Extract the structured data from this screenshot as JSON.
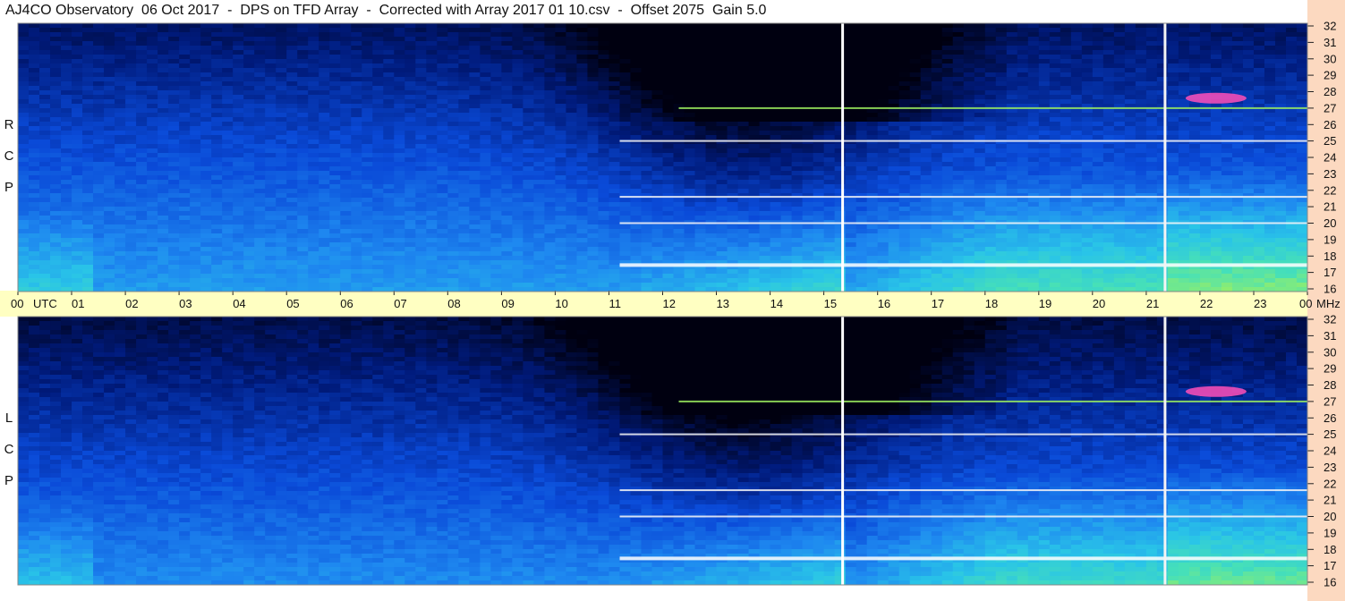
{
  "title": "AJ4CO Observatory  06 Oct 2017  -  DPS on TFD Array  -  Corrected with Array 2017 01 10.csv  -  Offset 2075  Gain 5.0",
  "panels": {
    "top_label": [
      "R",
      "C",
      "P"
    ],
    "bottom_label": [
      "L",
      "C",
      "P"
    ]
  },
  "colors": {
    "background": "#ffffff",
    "utc_bar": "#ffffc2",
    "freq_strip": "#fcd9c0",
    "colormap": [
      "#000010",
      "#001a7a",
      "#0a4ad8",
      "#1e88f0",
      "#29c4e8",
      "#46e0b8",
      "#9ef060",
      "#f0f030",
      "#ff60c0",
      "#ffffff"
    ]
  },
  "chart_data": {
    "type": "heatmap",
    "description_units": "dynamic spectrum: x = UTC hour, y = frequency in MHz",
    "x_axis": {
      "unit_label": "UTC",
      "range": [
        0,
        24
      ],
      "tick_labels": [
        "00",
        "01",
        "02",
        "03",
        "04",
        "05",
        "06",
        "07",
        "08",
        "09",
        "10",
        "11",
        "12",
        "13",
        "14",
        "15",
        "16",
        "17",
        "18",
        "19",
        "20",
        "21",
        "22",
        "23",
        "00"
      ]
    },
    "y_axis": {
      "unit_label": "MHz",
      "range": [
        16,
        32
      ],
      "tick_labels": [
        "32",
        "31",
        "30",
        "29",
        "28",
        "27",
        "26",
        "25",
        "24",
        "23",
        "22",
        "21",
        "20",
        "19",
        "18",
        "17",
        "16"
      ]
    },
    "panels": [
      {
        "polarization": "RCP"
      },
      {
        "polarization": "LCP"
      }
    ],
    "vertical_markers_utc": [
      15.35,
      21.35
    ],
    "interference_bands_mhz": [
      27.0,
      25.0,
      21.6,
      20.0,
      17.5
    ]
  }
}
